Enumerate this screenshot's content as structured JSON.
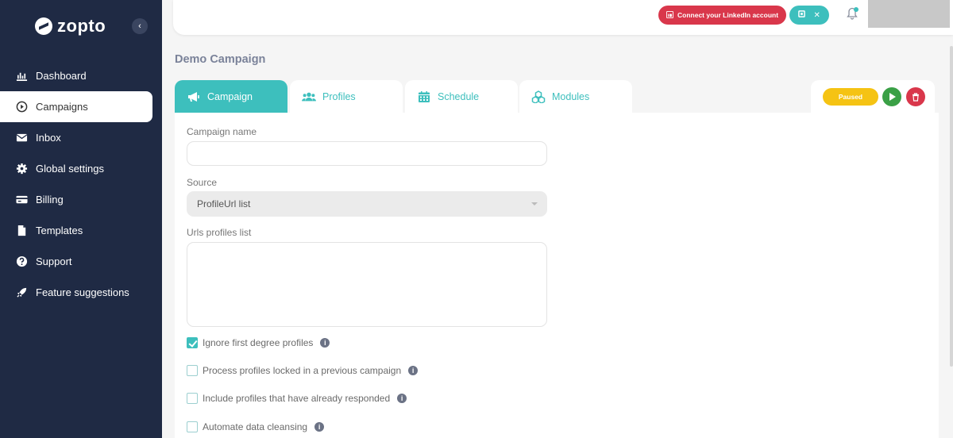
{
  "brand": {
    "name": "zopto"
  },
  "sidebar": {
    "items": [
      {
        "label": "Dashboard",
        "icon": "chart-icon",
        "active": false
      },
      {
        "label": "Campaigns",
        "icon": "play-circle-icon",
        "active": true
      },
      {
        "label": "Inbox",
        "icon": "envelope-icon",
        "active": false
      },
      {
        "label": "Global settings",
        "icon": "gear-icon",
        "active": false
      },
      {
        "label": "Billing",
        "icon": "credit-card-icon",
        "active": false
      },
      {
        "label": "Templates",
        "icon": "document-icon",
        "active": false
      },
      {
        "label": "Support",
        "icon": "question-circle-icon",
        "active": false
      },
      {
        "label": "Feature suggestions",
        "icon": "rocket-icon",
        "active": false
      }
    ]
  },
  "header": {
    "linkedin_button": "Connect your LinkedIn account"
  },
  "page": {
    "title": "Demo Campaign"
  },
  "tabs": [
    {
      "label": "Campaign",
      "active": true
    },
    {
      "label": "Profiles",
      "active": false
    },
    {
      "label": "Schedule",
      "active": false
    },
    {
      "label": "Modules",
      "active": false
    }
  ],
  "status": {
    "label": "Paused"
  },
  "form": {
    "campaign_name": {
      "label": "Campaign name",
      "value": ""
    },
    "source": {
      "label": "Source",
      "value": "ProfileUrl list"
    },
    "urls": {
      "label": "Urls profiles list",
      "value": ""
    },
    "checkboxes": [
      {
        "label": "Ignore first degree profiles",
        "checked": true
      },
      {
        "label": "Process profiles locked in a previous campaign",
        "checked": false
      },
      {
        "label": "Include profiles that have already responded",
        "checked": false
      },
      {
        "label": "Automate data cleansing",
        "checked": false
      }
    ]
  },
  "colors": {
    "sidebar_bg": "#1f2a44",
    "accent_teal": "#3dbfbd",
    "danger": "#d9374b",
    "paused": "#f5c313",
    "success": "#3aa046"
  }
}
